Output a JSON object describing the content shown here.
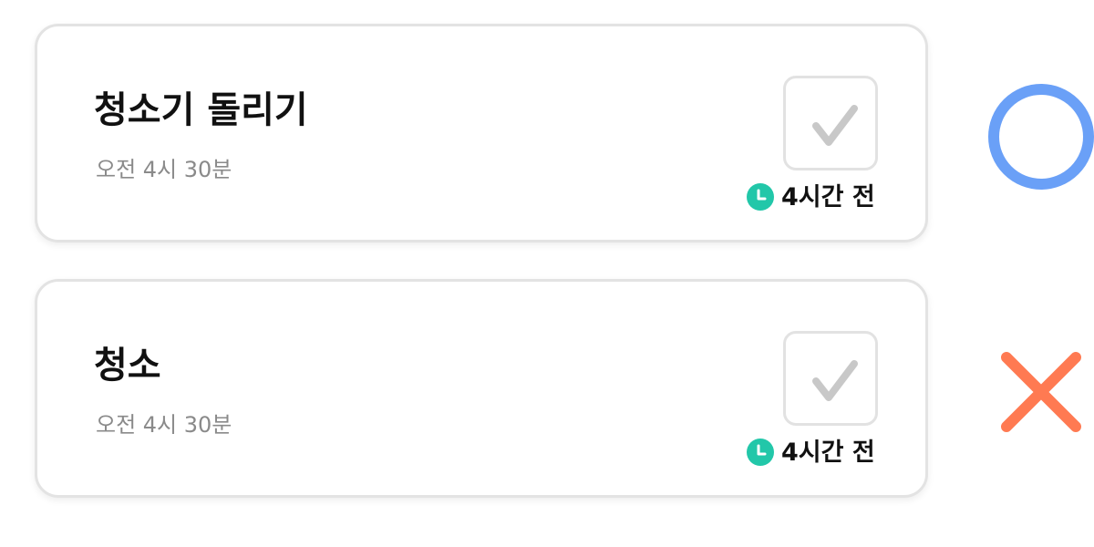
{
  "tasks": [
    {
      "title": "청소기 돌리기",
      "time": "오전 4시 30분",
      "elapsed": "4시간 전",
      "checked": false,
      "status_mark": "circle-icon"
    },
    {
      "title": "청소",
      "time": "오전 4시 30분",
      "elapsed": "4시간 전",
      "checked": false,
      "status_mark": "x-mark-icon"
    }
  ],
  "colors": {
    "circle": "#6aa0f7",
    "x_mark": "#ff7a52",
    "clock": "#22c7a9",
    "checkmark": "#c8c8c8",
    "card_border": "#e3e3e3"
  }
}
